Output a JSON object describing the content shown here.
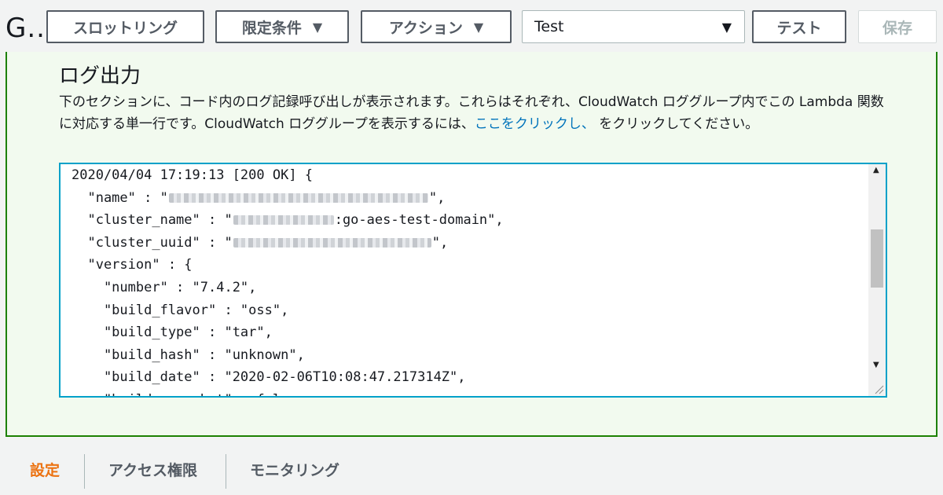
{
  "function_title": "G..",
  "toolbar": {
    "throttling_label": "スロットリング",
    "qualifiers_label": "限定条件",
    "actions_label": "アクション",
    "test_event_value": "Test",
    "test_button_label": "テスト",
    "save_button_label": "保存"
  },
  "log_output": {
    "title": "ログ出力",
    "description_prefix": "下のセクションに、コード内のログ記録呼び出しが表示されます。これらはそれぞれ、CloudWatch ロググループ内でこの Lambda 関数に対応する単一行です。CloudWatch ロググループを表示するには、",
    "description_link": "ここをクリックし、",
    "description_suffix": " をクリックしてください。",
    "lines": {
      "l0": "2020/04/04 17:19:13 [200 OK] {",
      "l1_pre": "  \"name\" : \"",
      "l1_post": "\",",
      "l2_pre": "  \"cluster_name\" : \"",
      "l2_post": ":go-aes-test-domain\",",
      "l3_pre": "  \"cluster_uuid\" : \"",
      "l3_post": "\",",
      "l4": "  \"version\" : {",
      "l5": "    \"number\" : \"7.4.2\",",
      "l6": "    \"build_flavor\" : \"oss\",",
      "l7": "    \"build_type\" : \"tar\",",
      "l8": "    \"build_hash\" : \"unknown\",",
      "l9": "    \"build_date\" : \"2020-02-06T10:08:47.217314Z\",",
      "l10": "    \"build_snapshot\" : false,"
    }
  },
  "tabs": {
    "settings": "設定",
    "permissions": "アクセス権限",
    "monitoring": "モニタリング"
  },
  "colors": {
    "panel_border": "#1d8102",
    "log_border": "#00a1c9",
    "active_tab": "#ec7211",
    "link": "#0073bb"
  }
}
